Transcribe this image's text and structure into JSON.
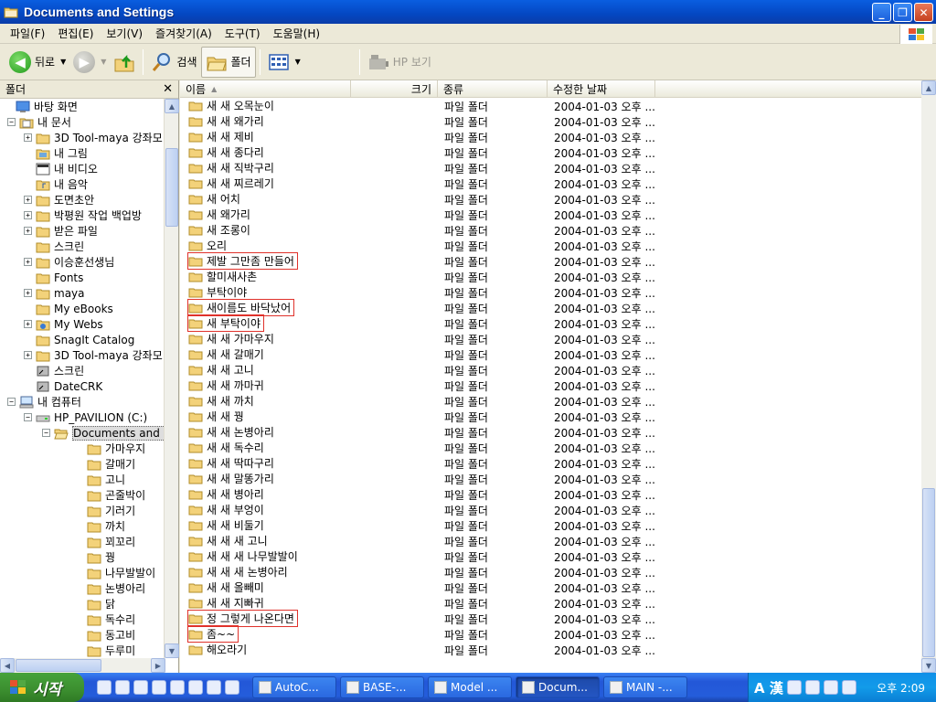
{
  "window": {
    "title": "Documents and Settings"
  },
  "menu": [
    "파일(F)",
    "편집(E)",
    "보기(V)",
    "즐겨찾기(A)",
    "도구(T)",
    "도움말(H)"
  ],
  "toolbar": {
    "back": "뒤로",
    "search": "검색",
    "folders": "폴더",
    "hp_view": "HP 보기"
  },
  "folder_pane": {
    "title": "폴더",
    "close": "✕"
  },
  "tree": [
    {
      "label": "바탕 화면",
      "level": 0,
      "expander": "",
      "icon": "desktop-icon"
    },
    {
      "label": "내 문서",
      "level": 1,
      "expander": "−",
      "icon": "my-documents-icon"
    },
    {
      "label": "3D Tool-maya 강좌모",
      "level": 2,
      "expander": "+",
      "icon": "folder-icon"
    },
    {
      "label": "내 그림",
      "level": 2,
      "expander": "",
      "icon": "pictures-folder-icon"
    },
    {
      "label": "내 비디오",
      "level": 2,
      "expander": "",
      "icon": "video-folder-icon"
    },
    {
      "label": "내 음악",
      "level": 2,
      "expander": "",
      "icon": "music-folder-icon"
    },
    {
      "label": "도면초안",
      "level": 2,
      "expander": "+",
      "icon": "folder-icon"
    },
    {
      "label": "박평원 작업 백업방",
      "level": 2,
      "expander": "+",
      "icon": "folder-icon"
    },
    {
      "label": "받은 파일",
      "level": 2,
      "expander": "+",
      "icon": "folder-icon"
    },
    {
      "label": "스크린",
      "level": 2,
      "expander": "",
      "icon": "folder-icon"
    },
    {
      "label": "이승훈선생님",
      "level": 2,
      "expander": "+",
      "icon": "folder-icon"
    },
    {
      "label": "Fonts",
      "level": 2,
      "expander": "",
      "icon": "folder-icon"
    },
    {
      "label": "maya",
      "level": 2,
      "expander": "+",
      "icon": "folder-icon"
    },
    {
      "label": "My eBooks",
      "level": 2,
      "expander": "",
      "icon": "folder-icon"
    },
    {
      "label": "My Webs",
      "level": 2,
      "expander": "+",
      "icon": "web-folder-icon"
    },
    {
      "label": "SnagIt Catalog",
      "level": 2,
      "expander": "",
      "icon": "folder-icon"
    },
    {
      "label": "3D Tool-maya 강좌모",
      "level": 2,
      "expander": "+",
      "icon": "folder-icon"
    },
    {
      "label": "스크린",
      "level": 2,
      "expander": "",
      "icon": "shortcut-icon"
    },
    {
      "label": "DateCRK",
      "level": 2,
      "expander": "",
      "icon": "shortcut-icon"
    },
    {
      "label": "내 컴퓨터",
      "level": 1,
      "expander": "−",
      "icon": "my-computer-icon"
    },
    {
      "label": "HP_PAVILION (C:)",
      "level": 2,
      "expander": "−",
      "icon": "drive-icon"
    },
    {
      "label": "Documents and S",
      "level": 3,
      "expander": "−",
      "icon": "open-folder-icon",
      "selected": true
    },
    {
      "label": "가마우지",
      "level": 4,
      "expander": "",
      "icon": "folder-icon"
    },
    {
      "label": "갈매기",
      "level": 4,
      "expander": "",
      "icon": "folder-icon"
    },
    {
      "label": "고니",
      "level": 4,
      "expander": "",
      "icon": "folder-icon"
    },
    {
      "label": "곤줄박이",
      "level": 4,
      "expander": "",
      "icon": "folder-icon"
    },
    {
      "label": "기러기",
      "level": 4,
      "expander": "",
      "icon": "folder-icon"
    },
    {
      "label": "까치",
      "level": 4,
      "expander": "",
      "icon": "folder-icon"
    },
    {
      "label": "꾀꼬리",
      "level": 4,
      "expander": "",
      "icon": "folder-icon"
    },
    {
      "label": "꿩",
      "level": 4,
      "expander": "",
      "icon": "folder-icon"
    },
    {
      "label": "나무발발이",
      "level": 4,
      "expander": "",
      "icon": "folder-icon"
    },
    {
      "label": "논병아리",
      "level": 4,
      "expander": "",
      "icon": "folder-icon"
    },
    {
      "label": "닭",
      "level": 4,
      "expander": "",
      "icon": "folder-icon"
    },
    {
      "label": "독수리",
      "level": 4,
      "expander": "",
      "icon": "folder-icon"
    },
    {
      "label": "동고비",
      "level": 4,
      "expander": "",
      "icon": "folder-icon"
    },
    {
      "label": "두루미",
      "level": 4,
      "expander": "",
      "icon": "folder-icon"
    }
  ],
  "columns": {
    "name": "이름",
    "size": "크기",
    "type": "종류",
    "modified": "수정한 날짜"
  },
  "files": [
    {
      "name": "새 새 오목눈이",
      "type": "파일 폴더",
      "modified": "2004-01-03 오후 ..."
    },
    {
      "name": "새 새 왜가리",
      "type": "파일 폴더",
      "modified": "2004-01-03 오후 ..."
    },
    {
      "name": "새 새 제비",
      "type": "파일 폴더",
      "modified": "2004-01-03 오후 ..."
    },
    {
      "name": "새 새 종다리",
      "type": "파일 폴더",
      "modified": "2004-01-03 오후 ..."
    },
    {
      "name": "새 새 직박구리",
      "type": "파일 폴더",
      "modified": "2004-01-03 오후 ..."
    },
    {
      "name": "새 새 찌르레기",
      "type": "파일 폴더",
      "modified": "2004-01-03 오후 ..."
    },
    {
      "name": "새 어치",
      "type": "파일 폴더",
      "modified": "2004-01-03 오후 ..."
    },
    {
      "name": "새 왜가리",
      "type": "파일 폴더",
      "modified": "2004-01-03 오후 ..."
    },
    {
      "name": "새 조롱이",
      "type": "파일 폴더",
      "modified": "2004-01-03 오후 ..."
    },
    {
      "name": "오리",
      "type": "파일 폴더",
      "modified": "2004-01-03 오후 ..."
    },
    {
      "name": "제발 그만좀 만들어",
      "type": "파일 폴더",
      "modified": "2004-01-03 오후 ...",
      "marked": true
    },
    {
      "name": "할미새사촌",
      "type": "파일 폴더",
      "modified": "2004-01-03 오후 ..."
    },
    {
      "name": "부탁이야",
      "type": "파일 폴더",
      "modified": "2004-01-03 오후 ..."
    },
    {
      "name": "새이름도 바닥났어",
      "type": "파일 폴더",
      "modified": "2004-01-03 오후 ...",
      "marked": true
    },
    {
      "name": "새 부탁이야",
      "type": "파일 폴더",
      "modified": "2004-01-03 오후 ...",
      "marked": true
    },
    {
      "name": "새 새 가마우지",
      "type": "파일 폴더",
      "modified": "2004-01-03 오후 ..."
    },
    {
      "name": "새 새 갈매기",
      "type": "파일 폴더",
      "modified": "2004-01-03 오후 ..."
    },
    {
      "name": "새 새 고니",
      "type": "파일 폴더",
      "modified": "2004-01-03 오후 ..."
    },
    {
      "name": "새 새 까마귀",
      "type": "파일 폴더",
      "modified": "2004-01-03 오후 ..."
    },
    {
      "name": "새 새 까치",
      "type": "파일 폴더",
      "modified": "2004-01-03 오후 ..."
    },
    {
      "name": "새 새 꿩",
      "type": "파일 폴더",
      "modified": "2004-01-03 오후 ..."
    },
    {
      "name": "새 새 논병아리",
      "type": "파일 폴더",
      "modified": "2004-01-03 오후 ..."
    },
    {
      "name": "새 새 독수리",
      "type": "파일 폴더",
      "modified": "2004-01-03 오후 ..."
    },
    {
      "name": "새 새 딱따구리",
      "type": "파일 폴더",
      "modified": "2004-01-03 오후 ..."
    },
    {
      "name": "새 새 말똥가리",
      "type": "파일 폴더",
      "modified": "2004-01-03 오후 ..."
    },
    {
      "name": "새 새 병아리",
      "type": "파일 폴더",
      "modified": "2004-01-03 오후 ..."
    },
    {
      "name": "새 새 부엉이",
      "type": "파일 폴더",
      "modified": "2004-01-03 오후 ..."
    },
    {
      "name": "새 새 비둘기",
      "type": "파일 폴더",
      "modified": "2004-01-03 오후 ..."
    },
    {
      "name": "새 새 새 고니",
      "type": "파일 폴더",
      "modified": "2004-01-03 오후 ..."
    },
    {
      "name": "새 새 새 나무발발이",
      "type": "파일 폴더",
      "modified": "2004-01-03 오후 ..."
    },
    {
      "name": "새 새 새 논병아리",
      "type": "파일 폴더",
      "modified": "2004-01-03 오후 ..."
    },
    {
      "name": "새 새 올빼미",
      "type": "파일 폴더",
      "modified": "2004-01-03 오후 ..."
    },
    {
      "name": "새 새 지빠귀",
      "type": "파일 폴더",
      "modified": "2004-01-03 오후 ..."
    },
    {
      "name": "정 그렇게 나온다면",
      "type": "파일 폴더",
      "modified": "2004-01-03 오후 ...",
      "marked": true
    },
    {
      "name": "좀~~",
      "type": "파일 폴더",
      "modified": "2004-01-03 오후 ...",
      "marked": true
    },
    {
      "name": "해오라기",
      "type": "파일 폴더",
      "modified": "2004-01-03 오후 ..."
    }
  ],
  "taskbar": {
    "start": "시작",
    "tasks": [
      {
        "label": "AutoC...",
        "active": false
      },
      {
        "label": "BASE-...",
        "active": false
      },
      {
        "label": "Model ...",
        "active": false
      },
      {
        "label": "Docum...",
        "active": true
      },
      {
        "label": "MAIN -...",
        "active": false
      }
    ],
    "ime": "A 漢",
    "clock": "오후 2:09"
  },
  "colors": {
    "title_bar": "#0a5ee0",
    "taskbar": "#245ddb",
    "start": "#3b8e2f",
    "folder": "#f3d27a",
    "highlight": "#e0322b"
  }
}
